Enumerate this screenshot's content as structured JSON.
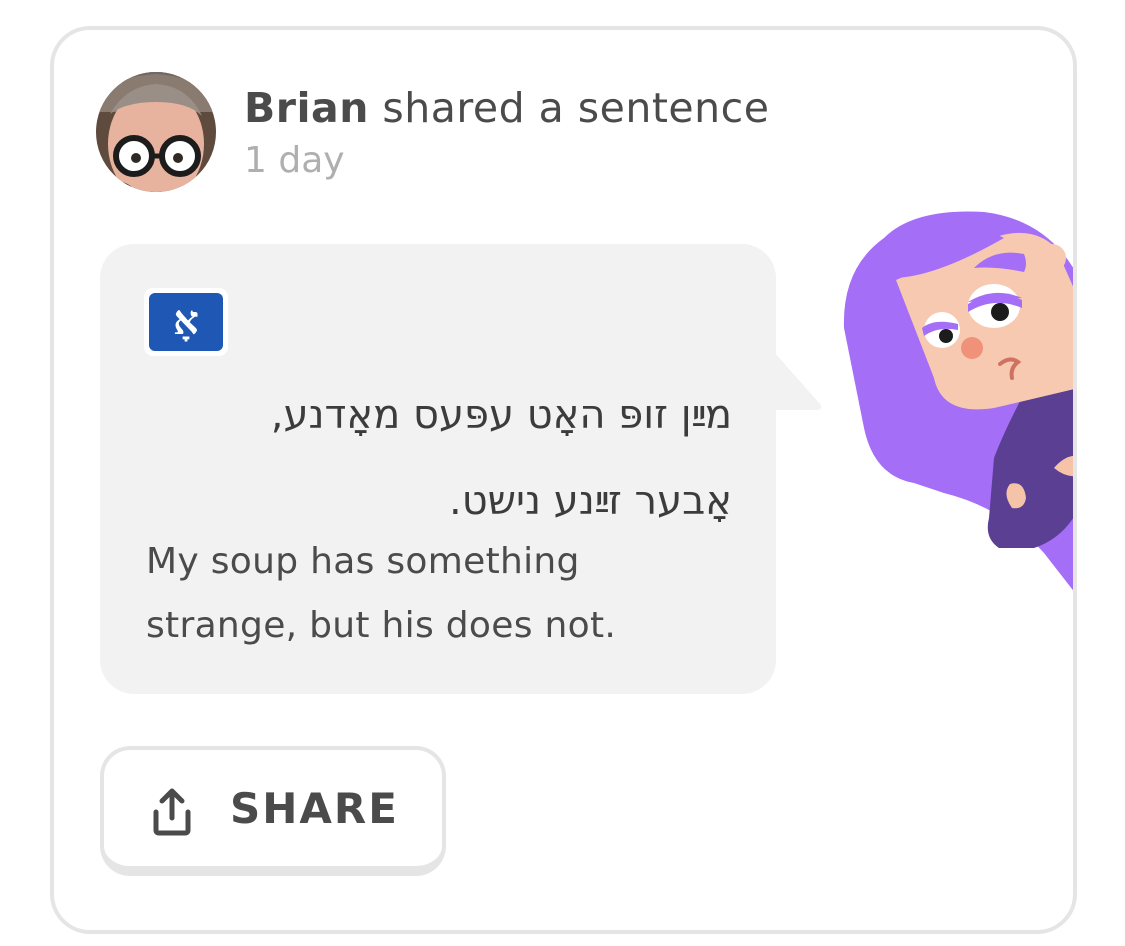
{
  "post": {
    "user_name": "Brian",
    "action_text": " shared a sentence",
    "timestamp": "1 day"
  },
  "sentence": {
    "language_flag_letter": "אָ",
    "language_flag_color": "#1f57b5",
    "source_lines": [
      "מײַן זופּ האָט עפּעס מאָדנע,",
      "אָבער זײַנע נישט."
    ],
    "translation": "My soup has something strange, but his does not."
  },
  "share_button": {
    "label": "SHARE",
    "icon": "share-icon"
  },
  "character": {
    "icon": "character-illustration",
    "hair_color": "#a56ef7"
  },
  "colors": {
    "bubble": "#f2f2f2",
    "border": "#e5e5e5",
    "text": "#4b4b4b",
    "muted": "#afafaf"
  }
}
